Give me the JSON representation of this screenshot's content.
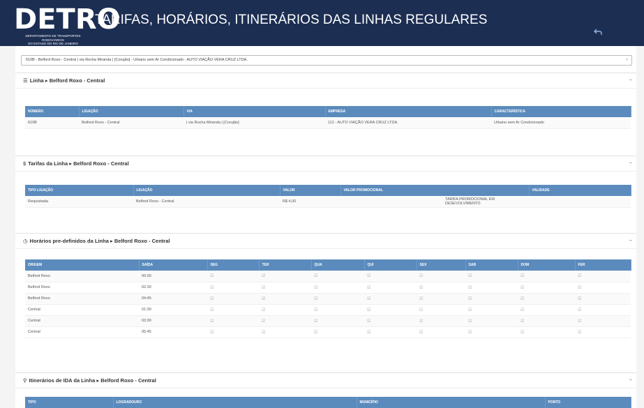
{
  "header": {
    "logo": "DETRO",
    "logo_subtitle_1": "DEPARTAMENTO DE TRANSPORTES RODOVIÁRIOS",
    "logo_subtitle_2": "DO ESTADO DO RIO DE JANEIRO",
    "title": "TARIFAS, HORÁRIOS, ITINERÁRIOS DAS LINHAS REGULARES",
    "back_icon": "back-arrow-icon"
  },
  "line_select": {
    "value": "610B - Belford Roxo - Central | via Rocha Miranda | [Corujão] - Urbano sem Ar Condicionado - AUTO VIAÇÃO VERA CRUZ LTDA.",
    "arrow": "˅"
  },
  "panel_linha": {
    "icon": "☰",
    "label": "Linha",
    "sep": "▸",
    "route": "Belford Roxo - Central",
    "collapse": "−",
    "columns": [
      "NÚMERO",
      "LIGAÇÃO",
      "VIA",
      "EMPRESA",
      "CARACTERÍSTICA"
    ],
    "row": [
      "610B",
      "Belford Roxo - Central",
      "| via Rocha Miranda | [Corujão]",
      "112 - AUTO VIAÇÃO VERA CRUZ LTDA.",
      "Urbano sem Ar Condicionado"
    ]
  },
  "panel_tarifas": {
    "icon": "$",
    "label": "Tarifas da Linha",
    "sep": "▸",
    "route": "Belford Roxo - Central",
    "collapse": "−",
    "columns": [
      "TIPO LIGAÇÃO",
      "LIGAÇÃO",
      "VALOR",
      "VALOR PROMOCIONAL",
      "VALIDADE"
    ],
    "row": [
      "Requisitada",
      "Belford Roxo - Central",
      "R$ 4,00",
      "TARIFA PROMOCIONAL EM DESEVOLVIMENTO",
      ""
    ]
  },
  "panel_horarios": {
    "icon": "◷",
    "label": "Horários pre-definidos da Linha",
    "sep": "▸",
    "route": "Belford Roxo - Central",
    "collapse": "−",
    "columns": [
      "ORIGEM",
      "SAÍDA",
      "SEG",
      "TER",
      "QUA",
      "QUI",
      "SEX",
      "SAB",
      "DOM",
      "FER"
    ],
    "check": "☑",
    "rows": [
      [
        "Belford Roxo",
        "00:30"
      ],
      [
        "Belford Roxo",
        "02:30"
      ],
      [
        "Belford Roxo",
        "04:45"
      ],
      [
        "Central",
        "01:30"
      ],
      [
        "Central",
        "03:30"
      ],
      [
        "Central",
        "05:45"
      ]
    ]
  },
  "panel_itinerarios": {
    "icon": "⚲",
    "label": "Itinerários de IDA da Linha",
    "sep": "▸",
    "route": "Belford Roxo - Central",
    "collapse": "−",
    "columns": [
      "TIPO",
      "LOGRADOURO",
      "MUNICÍPIO",
      "PONTO"
    ]
  }
}
